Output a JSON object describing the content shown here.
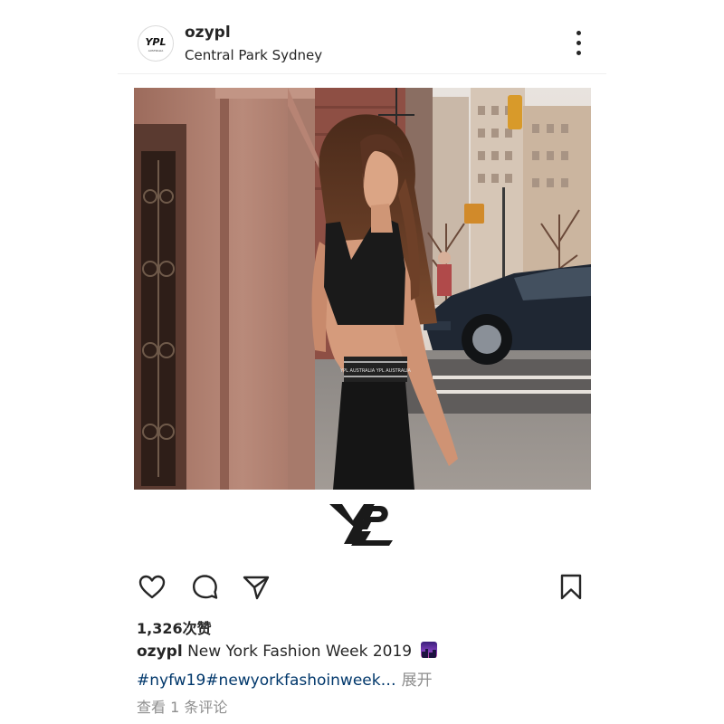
{
  "post": {
    "username": "ozypl",
    "location": "Central Park Sydney",
    "avatar_logo": "YPL",
    "avatar_subtext": "AUSTRALIA",
    "brand_logo": "YPL",
    "likes": "1,326次赞",
    "caption_user": "ozypl",
    "caption_text": "New York Fashion Week 2019",
    "caption_emoji": "night-with-stars-emoji",
    "hashtags_text": "#nyfw19#newyorkfashoinweek…",
    "more_label": "展开",
    "view_comments": "查看 1 条评论",
    "waistband_text": "YPL AUSTRALIA YPL AUSTRALIA"
  },
  "icons": {
    "more": "more-vertical-icon",
    "like": "heart-icon",
    "comment": "comment-bubble-icon",
    "share": "paper-plane-icon",
    "save": "bookmark-icon"
  },
  "colors": {
    "text": "#262626",
    "hashtag": "#00376b",
    "muted": "#8e8e8e"
  }
}
